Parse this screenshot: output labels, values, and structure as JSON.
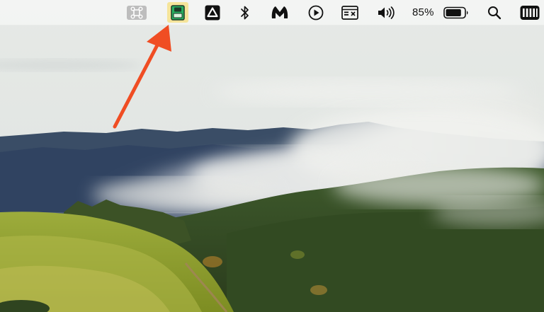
{
  "menubar": {
    "icons": [
      {
        "name": "command-key-icon"
      },
      {
        "name": "app-status-icon",
        "highlighted": true
      },
      {
        "name": "google-drive-icon"
      },
      {
        "name": "bluetooth-icon"
      },
      {
        "name": "malwarebytes-icon"
      },
      {
        "name": "play-circle-icon"
      },
      {
        "name": "keyboard-input-icon"
      },
      {
        "name": "volume-icon"
      },
      {
        "name": "spotlight-search-icon"
      },
      {
        "name": "control-strip-icon"
      }
    ],
    "battery": {
      "percent_label": "85%",
      "level": 0.85,
      "icon": "battery-icon"
    }
  },
  "annotation": {
    "type": "arrow",
    "color": "#f04d23",
    "points_to": "app-status-icon"
  },
  "colors": {
    "highlight": "#f5e49a",
    "arrow": "#f04d23",
    "icon": "#1a1a1a"
  },
  "wallpaper": {
    "scene": "foggy-forest-hills"
  }
}
